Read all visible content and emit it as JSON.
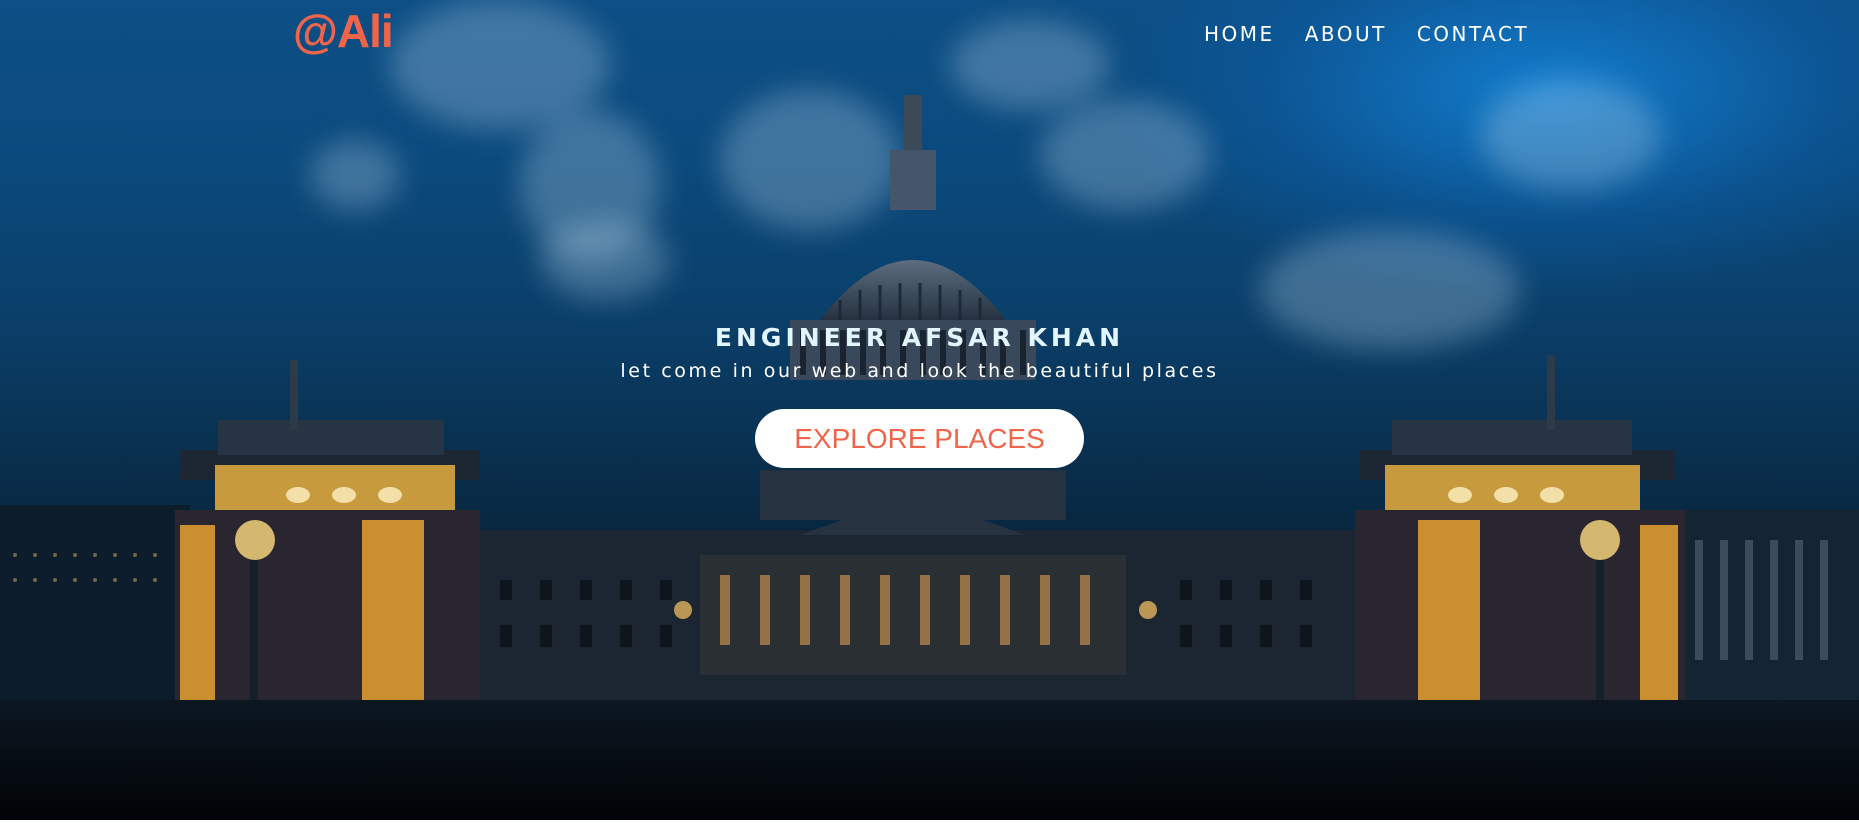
{
  "brand": {
    "logo_text": "@Ali",
    "accent_color": "#f0654a"
  },
  "nav": {
    "items": [
      {
        "label": "HOME"
      },
      {
        "label": "ABOUT"
      },
      {
        "label": "CONTACT"
      }
    ]
  },
  "hero": {
    "title": "ENGINEER AFSAR KHAN",
    "subtitle": "let come in our web and look the beautiful places",
    "cta_label": "EXPLORE PLACES"
  }
}
